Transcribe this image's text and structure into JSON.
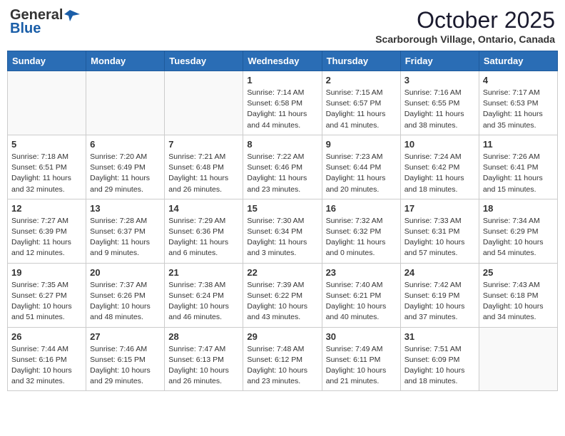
{
  "header": {
    "logo_general": "General",
    "logo_blue": "Blue",
    "month_title": "October 2025",
    "location": "Scarborough Village, Ontario, Canada"
  },
  "weekdays": [
    "Sunday",
    "Monday",
    "Tuesday",
    "Wednesday",
    "Thursday",
    "Friday",
    "Saturday"
  ],
  "weeks": [
    [
      {
        "day": "",
        "info": ""
      },
      {
        "day": "",
        "info": ""
      },
      {
        "day": "",
        "info": ""
      },
      {
        "day": "1",
        "info": "Sunrise: 7:14 AM\nSunset: 6:58 PM\nDaylight: 11 hours\nand 44 minutes."
      },
      {
        "day": "2",
        "info": "Sunrise: 7:15 AM\nSunset: 6:57 PM\nDaylight: 11 hours\nand 41 minutes."
      },
      {
        "day": "3",
        "info": "Sunrise: 7:16 AM\nSunset: 6:55 PM\nDaylight: 11 hours\nand 38 minutes."
      },
      {
        "day": "4",
        "info": "Sunrise: 7:17 AM\nSunset: 6:53 PM\nDaylight: 11 hours\nand 35 minutes."
      }
    ],
    [
      {
        "day": "5",
        "info": "Sunrise: 7:18 AM\nSunset: 6:51 PM\nDaylight: 11 hours\nand 32 minutes."
      },
      {
        "day": "6",
        "info": "Sunrise: 7:20 AM\nSunset: 6:49 PM\nDaylight: 11 hours\nand 29 minutes."
      },
      {
        "day": "7",
        "info": "Sunrise: 7:21 AM\nSunset: 6:48 PM\nDaylight: 11 hours\nand 26 minutes."
      },
      {
        "day": "8",
        "info": "Sunrise: 7:22 AM\nSunset: 6:46 PM\nDaylight: 11 hours\nand 23 minutes."
      },
      {
        "day": "9",
        "info": "Sunrise: 7:23 AM\nSunset: 6:44 PM\nDaylight: 11 hours\nand 20 minutes."
      },
      {
        "day": "10",
        "info": "Sunrise: 7:24 AM\nSunset: 6:42 PM\nDaylight: 11 hours\nand 18 minutes."
      },
      {
        "day": "11",
        "info": "Sunrise: 7:26 AM\nSunset: 6:41 PM\nDaylight: 11 hours\nand 15 minutes."
      }
    ],
    [
      {
        "day": "12",
        "info": "Sunrise: 7:27 AM\nSunset: 6:39 PM\nDaylight: 11 hours\nand 12 minutes."
      },
      {
        "day": "13",
        "info": "Sunrise: 7:28 AM\nSunset: 6:37 PM\nDaylight: 11 hours\nand 9 minutes."
      },
      {
        "day": "14",
        "info": "Sunrise: 7:29 AM\nSunset: 6:36 PM\nDaylight: 11 hours\nand 6 minutes."
      },
      {
        "day": "15",
        "info": "Sunrise: 7:30 AM\nSunset: 6:34 PM\nDaylight: 11 hours\nand 3 minutes."
      },
      {
        "day": "16",
        "info": "Sunrise: 7:32 AM\nSunset: 6:32 PM\nDaylight: 11 hours\nand 0 minutes."
      },
      {
        "day": "17",
        "info": "Sunrise: 7:33 AM\nSunset: 6:31 PM\nDaylight: 10 hours\nand 57 minutes."
      },
      {
        "day": "18",
        "info": "Sunrise: 7:34 AM\nSunset: 6:29 PM\nDaylight: 10 hours\nand 54 minutes."
      }
    ],
    [
      {
        "day": "19",
        "info": "Sunrise: 7:35 AM\nSunset: 6:27 PM\nDaylight: 10 hours\nand 51 minutes."
      },
      {
        "day": "20",
        "info": "Sunrise: 7:37 AM\nSunset: 6:26 PM\nDaylight: 10 hours\nand 48 minutes."
      },
      {
        "day": "21",
        "info": "Sunrise: 7:38 AM\nSunset: 6:24 PM\nDaylight: 10 hours\nand 46 minutes."
      },
      {
        "day": "22",
        "info": "Sunrise: 7:39 AM\nSunset: 6:22 PM\nDaylight: 10 hours\nand 43 minutes."
      },
      {
        "day": "23",
        "info": "Sunrise: 7:40 AM\nSunset: 6:21 PM\nDaylight: 10 hours\nand 40 minutes."
      },
      {
        "day": "24",
        "info": "Sunrise: 7:42 AM\nSunset: 6:19 PM\nDaylight: 10 hours\nand 37 minutes."
      },
      {
        "day": "25",
        "info": "Sunrise: 7:43 AM\nSunset: 6:18 PM\nDaylight: 10 hours\nand 34 minutes."
      }
    ],
    [
      {
        "day": "26",
        "info": "Sunrise: 7:44 AM\nSunset: 6:16 PM\nDaylight: 10 hours\nand 32 minutes."
      },
      {
        "day": "27",
        "info": "Sunrise: 7:46 AM\nSunset: 6:15 PM\nDaylight: 10 hours\nand 29 minutes."
      },
      {
        "day": "28",
        "info": "Sunrise: 7:47 AM\nSunset: 6:13 PM\nDaylight: 10 hours\nand 26 minutes."
      },
      {
        "day": "29",
        "info": "Sunrise: 7:48 AM\nSunset: 6:12 PM\nDaylight: 10 hours\nand 23 minutes."
      },
      {
        "day": "30",
        "info": "Sunrise: 7:49 AM\nSunset: 6:11 PM\nDaylight: 10 hours\nand 21 minutes."
      },
      {
        "day": "31",
        "info": "Sunrise: 7:51 AM\nSunset: 6:09 PM\nDaylight: 10 hours\nand 18 minutes."
      },
      {
        "day": "",
        "info": ""
      }
    ]
  ]
}
